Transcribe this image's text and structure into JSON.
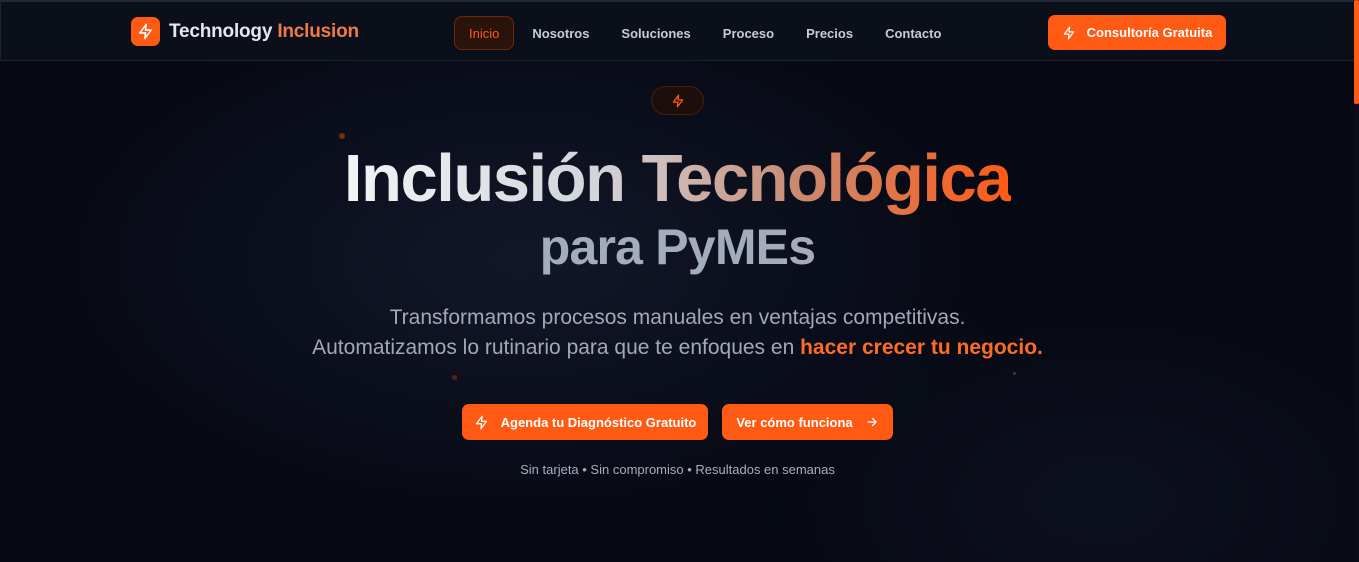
{
  "nav": {
    "brand": {
      "word1": "Technology",
      "word2": "Inclusion",
      "logo_icon": "bolt-icon"
    },
    "items": [
      {
        "label": "Inicio",
        "active": true
      },
      {
        "label": "Nosotros"
      },
      {
        "label": "Soluciones"
      },
      {
        "label": "Proceso"
      },
      {
        "label": "Precios"
      },
      {
        "label": "Contacto"
      }
    ],
    "cta_label": "Consultoría Gratuita"
  },
  "hero": {
    "badge_icon": "bolt-icon",
    "title_line1": "Inclusión Tecnológica",
    "title_line2": "para PyMEs",
    "subtitle_line1": "Transformamos procesos manuales en ventajas competitivas.",
    "subtitle_line2_prefix": "Automatizamos lo rutinario para que te enfoques en ",
    "subtitle_line2_highlight": "hacer crecer tu negocio.",
    "primary_button": "Agenda tu Diagnóstico Gratuito",
    "secondary_button": "Ver cómo funciona",
    "note": "Sin tarjeta • Sin compromiso • Resultados en semanas"
  },
  "colors": {
    "accent": "#ff5a14",
    "background": "#060913",
    "navbar": "#0b0f1a",
    "text_muted": "#a2a9b6"
  }
}
